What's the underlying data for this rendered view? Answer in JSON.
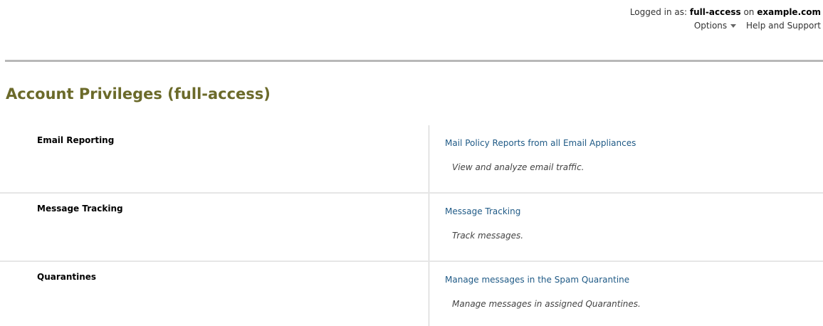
{
  "header": {
    "logged_in_prefix": "Logged in as:",
    "username": "full-access",
    "on_text": "on",
    "domain": "example.com",
    "options_label": "Options",
    "help_label": "Help and Support"
  },
  "page": {
    "title": "Account Privileges (full-access)"
  },
  "privileges": [
    {
      "name": "Email Reporting",
      "link": "Mail Policy Reports from all Email Appliances",
      "description": "View and analyze email traffic."
    },
    {
      "name": "Message Tracking",
      "link": "Message Tracking",
      "description": "Track messages."
    },
    {
      "name": "Quarantines",
      "link": "Manage messages in the Spam Quarantine",
      "description": "Manage messages in assigned Quarantines."
    }
  ],
  "colors": {
    "title": "#6b6a2a",
    "link": "#1f5a86",
    "rule": "#b8b8b8"
  }
}
